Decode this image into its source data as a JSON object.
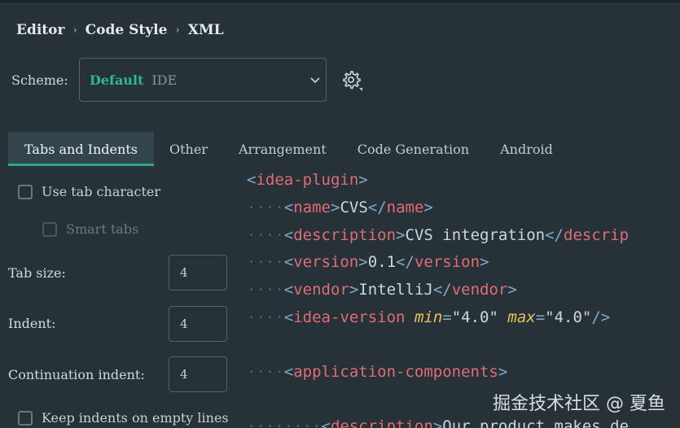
{
  "breadcrumb": {
    "items": [
      "Editor",
      "Code Style",
      "XML"
    ],
    "separator": "›"
  },
  "scheme": {
    "label": "Scheme:",
    "name": "Default",
    "type": "IDE"
  },
  "tabs": [
    "Tabs and Indents",
    "Other",
    "Arrangement",
    "Code Generation",
    "Android"
  ],
  "active_tab": "Tabs and Indents",
  "options": {
    "use_tab_character": {
      "label": "Use tab character",
      "checked": false
    },
    "smart_tabs": {
      "label": "Smart tabs",
      "checked": false,
      "enabled": false
    },
    "tab_size": {
      "label": "Tab size:",
      "value": "4"
    },
    "indent": {
      "label": "Indent:",
      "value": "4"
    },
    "continuation_indent": {
      "label": "Continuation indent:",
      "value": "4"
    },
    "keep_indents": {
      "label": "Keep indents on empty lines",
      "checked": false
    }
  },
  "preview": {
    "whitespace_marker": "····",
    "lines": [
      {
        "tag": "idea-plugin"
      },
      {
        "tag": "name",
        "text": "CVS"
      },
      {
        "tag": "description",
        "text": "CVS integration",
        "close": "descrip"
      },
      {
        "tag": "version",
        "text": "0.1"
      },
      {
        "tag": "vendor",
        "text": "IntelliJ"
      },
      {
        "tag": "idea-version",
        "attr1": "min",
        "val1": "\"4.0\"",
        "attr2": "max",
        "val2": "\"4.0\""
      },
      {
        "tag": "application-components"
      },
      {
        "tag": "description",
        "text": "Our product makes de"
      }
    ]
  },
  "watermark": "掘金技术社区 @ 夏鱼",
  "colors": {
    "background": "#263238",
    "accent": "#2aa88e",
    "scheme_name": "#2fb59a",
    "xml_tag": "#e06c75",
    "xml_bracket": "#7fa9c9",
    "xml_attr": "#e6c15c"
  },
  "icons": [
    "chevron-down-icon",
    "gear-icon"
  ]
}
